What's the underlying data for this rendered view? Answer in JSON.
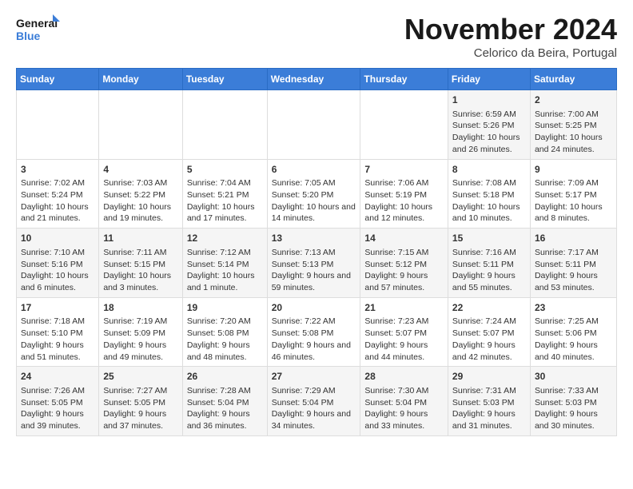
{
  "logo": {
    "line1": "General",
    "line2": "Blue"
  },
  "title": "November 2024",
  "location": "Celorico da Beira, Portugal",
  "days_of_week": [
    "Sunday",
    "Monday",
    "Tuesday",
    "Wednesday",
    "Thursday",
    "Friday",
    "Saturday"
  ],
  "weeks": [
    [
      {
        "day": "",
        "info": ""
      },
      {
        "day": "",
        "info": ""
      },
      {
        "day": "",
        "info": ""
      },
      {
        "day": "",
        "info": ""
      },
      {
        "day": "",
        "info": ""
      },
      {
        "day": "1",
        "info": "Sunrise: 6:59 AM\nSunset: 5:26 PM\nDaylight: 10 hours and 26 minutes."
      },
      {
        "day": "2",
        "info": "Sunrise: 7:00 AM\nSunset: 5:25 PM\nDaylight: 10 hours and 24 minutes."
      }
    ],
    [
      {
        "day": "3",
        "info": "Sunrise: 7:02 AM\nSunset: 5:24 PM\nDaylight: 10 hours and 21 minutes."
      },
      {
        "day": "4",
        "info": "Sunrise: 7:03 AM\nSunset: 5:22 PM\nDaylight: 10 hours and 19 minutes."
      },
      {
        "day": "5",
        "info": "Sunrise: 7:04 AM\nSunset: 5:21 PM\nDaylight: 10 hours and 17 minutes."
      },
      {
        "day": "6",
        "info": "Sunrise: 7:05 AM\nSunset: 5:20 PM\nDaylight: 10 hours and 14 minutes."
      },
      {
        "day": "7",
        "info": "Sunrise: 7:06 AM\nSunset: 5:19 PM\nDaylight: 10 hours and 12 minutes."
      },
      {
        "day": "8",
        "info": "Sunrise: 7:08 AM\nSunset: 5:18 PM\nDaylight: 10 hours and 10 minutes."
      },
      {
        "day": "9",
        "info": "Sunrise: 7:09 AM\nSunset: 5:17 PM\nDaylight: 10 hours and 8 minutes."
      }
    ],
    [
      {
        "day": "10",
        "info": "Sunrise: 7:10 AM\nSunset: 5:16 PM\nDaylight: 10 hours and 6 minutes."
      },
      {
        "day": "11",
        "info": "Sunrise: 7:11 AM\nSunset: 5:15 PM\nDaylight: 10 hours and 3 minutes."
      },
      {
        "day": "12",
        "info": "Sunrise: 7:12 AM\nSunset: 5:14 PM\nDaylight: 10 hours and 1 minute."
      },
      {
        "day": "13",
        "info": "Sunrise: 7:13 AM\nSunset: 5:13 PM\nDaylight: 9 hours and 59 minutes."
      },
      {
        "day": "14",
        "info": "Sunrise: 7:15 AM\nSunset: 5:12 PM\nDaylight: 9 hours and 57 minutes."
      },
      {
        "day": "15",
        "info": "Sunrise: 7:16 AM\nSunset: 5:11 PM\nDaylight: 9 hours and 55 minutes."
      },
      {
        "day": "16",
        "info": "Sunrise: 7:17 AM\nSunset: 5:11 PM\nDaylight: 9 hours and 53 minutes."
      }
    ],
    [
      {
        "day": "17",
        "info": "Sunrise: 7:18 AM\nSunset: 5:10 PM\nDaylight: 9 hours and 51 minutes."
      },
      {
        "day": "18",
        "info": "Sunrise: 7:19 AM\nSunset: 5:09 PM\nDaylight: 9 hours and 49 minutes."
      },
      {
        "day": "19",
        "info": "Sunrise: 7:20 AM\nSunset: 5:08 PM\nDaylight: 9 hours and 48 minutes."
      },
      {
        "day": "20",
        "info": "Sunrise: 7:22 AM\nSunset: 5:08 PM\nDaylight: 9 hours and 46 minutes."
      },
      {
        "day": "21",
        "info": "Sunrise: 7:23 AM\nSunset: 5:07 PM\nDaylight: 9 hours and 44 minutes."
      },
      {
        "day": "22",
        "info": "Sunrise: 7:24 AM\nSunset: 5:07 PM\nDaylight: 9 hours and 42 minutes."
      },
      {
        "day": "23",
        "info": "Sunrise: 7:25 AM\nSunset: 5:06 PM\nDaylight: 9 hours and 40 minutes."
      }
    ],
    [
      {
        "day": "24",
        "info": "Sunrise: 7:26 AM\nSunset: 5:05 PM\nDaylight: 9 hours and 39 minutes."
      },
      {
        "day": "25",
        "info": "Sunrise: 7:27 AM\nSunset: 5:05 PM\nDaylight: 9 hours and 37 minutes."
      },
      {
        "day": "26",
        "info": "Sunrise: 7:28 AM\nSunset: 5:04 PM\nDaylight: 9 hours and 36 minutes."
      },
      {
        "day": "27",
        "info": "Sunrise: 7:29 AM\nSunset: 5:04 PM\nDaylight: 9 hours and 34 minutes."
      },
      {
        "day": "28",
        "info": "Sunrise: 7:30 AM\nSunset: 5:04 PM\nDaylight: 9 hours and 33 minutes."
      },
      {
        "day": "29",
        "info": "Sunrise: 7:31 AM\nSunset: 5:03 PM\nDaylight: 9 hours and 31 minutes."
      },
      {
        "day": "30",
        "info": "Sunrise: 7:33 AM\nSunset: 5:03 PM\nDaylight: 9 hours and 30 minutes."
      }
    ]
  ]
}
